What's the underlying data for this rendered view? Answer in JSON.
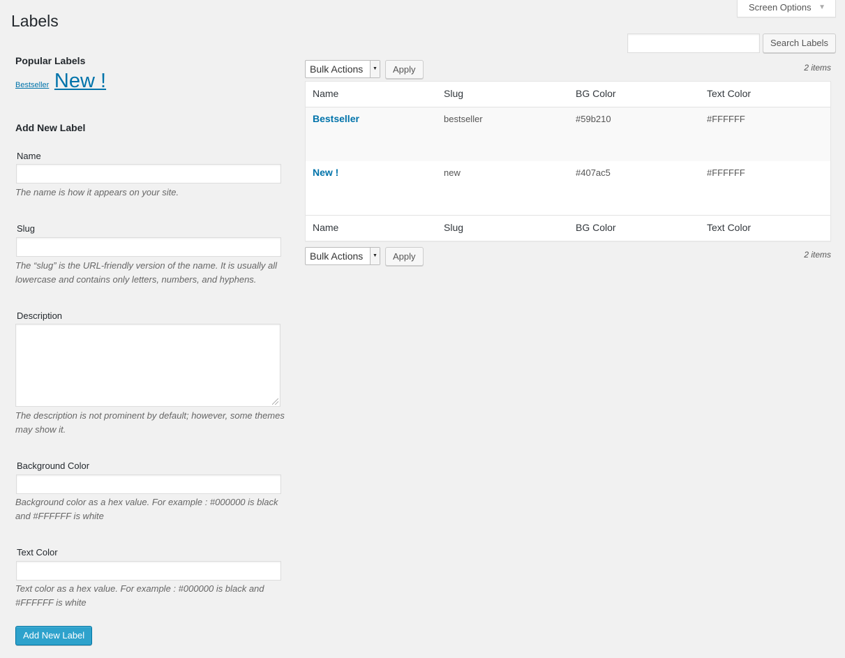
{
  "header": {
    "title": "Labels",
    "screen_options": "Screen Options"
  },
  "search": {
    "placeholder": "",
    "button": "Search Labels"
  },
  "popular": {
    "title": "Popular Labels",
    "tags": [
      "Bestseller",
      "New !"
    ]
  },
  "form": {
    "title": "Add New Label",
    "name": {
      "label": "Name",
      "help": "The name is how it appears on your site."
    },
    "slug": {
      "label": "Slug",
      "help": "The “slug” is the URL-friendly version of the name. It is usually all lowercase and contains only letters, numbers, and hyphens."
    },
    "description": {
      "label": "Description",
      "help": "The description is not prominent by default; however, some themes may show it."
    },
    "bg_color": {
      "label": "Background Color",
      "help": "Background color as a hex value. For example : #000000 is black and #FFFFFF is white"
    },
    "text_color": {
      "label": "Text Color",
      "help": "Text color as a hex value. For example : #000000 is black and #FFFFFF is white"
    },
    "submit": "Add New Label"
  },
  "tablenav": {
    "bulk_actions": "Bulk Actions",
    "apply": "Apply",
    "items_count": "2 items"
  },
  "table": {
    "columns": [
      "Name",
      "Slug",
      "BG Color",
      "Text Color"
    ],
    "rows": [
      {
        "name": "Bestseller",
        "slug": "bestseller",
        "bg": "#59b210",
        "text": "#FFFFFF"
      },
      {
        "name": "New !",
        "slug": "new",
        "bg": "#407ac5",
        "text": "#FFFFFF"
      }
    ]
  }
}
